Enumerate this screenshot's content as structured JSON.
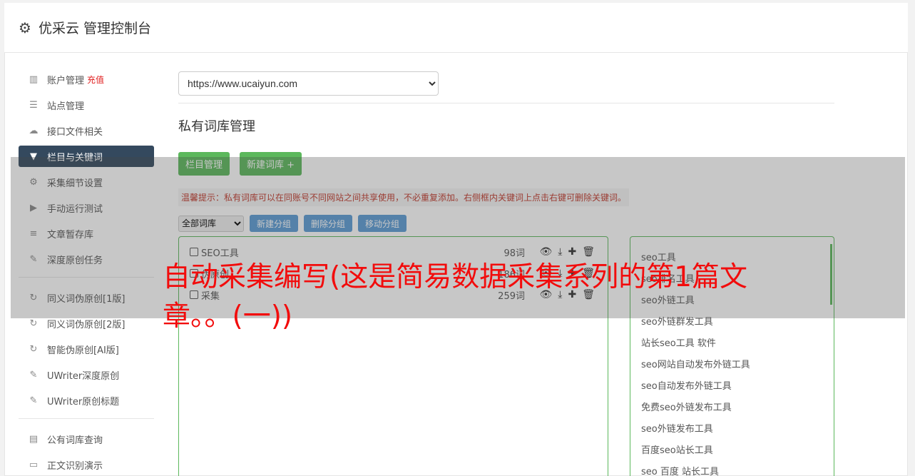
{
  "header": {
    "icon": "gear-icon",
    "title": "优采云 管理控制台"
  },
  "sidebar": {
    "group1": [
      {
        "label": "账户管理",
        "icon": "bar-chart-icon",
        "extra": "充值"
      },
      {
        "label": "站点管理",
        "icon": "server-icon"
      },
      {
        "label": "接口文件相关",
        "icon": "cloud-upload-icon"
      },
      {
        "label": "栏目与关键词",
        "icon": "filter-icon",
        "active": true
      },
      {
        "label": "采集细节设置",
        "icon": "cogs-icon"
      },
      {
        "label": "手动运行测试",
        "icon": "play-icon"
      },
      {
        "label": "文章暂存库",
        "icon": "database-icon"
      },
      {
        "label": "深度原创任务",
        "icon": "edit-icon"
      }
    ],
    "group2": [
      {
        "label": "同义词伪原创[1版]",
        "icon": "refresh-icon"
      },
      {
        "label": "同义词伪原创[2版]",
        "icon": "refresh-icon"
      },
      {
        "label": "智能伪原创[AI版]",
        "icon": "refresh-icon"
      },
      {
        "label": "UWriter深度原创",
        "icon": "edit-icon"
      },
      {
        "label": "UWriter原创标题",
        "icon": "edit-icon"
      }
    ],
    "group3": [
      {
        "label": "公有词库查询",
        "icon": "book-icon"
      },
      {
        "label": "正文识别演示",
        "icon": "monitor-icon"
      }
    ]
  },
  "main": {
    "site_select": "https://www.ucaiyun.com",
    "page_title": "私有词库管理",
    "btn_column": "栏目管理",
    "btn_new_lib": "新建词库 +",
    "tip": "温馨提示：私有词库可以在同账号不同网站之间共享使用，不必重复添加。右侧框内关键词上点击右键可删除关键词。",
    "group_select": "全部词库",
    "btn_new_group": "新建分组",
    "btn_delete_group": "删除分组",
    "btn_move_group": "移动分组",
    "libraries": [
      {
        "name": "SEO工具",
        "count": "98词"
      },
      {
        "name": "伪原创",
        "count": "186词"
      },
      {
        "name": "采集",
        "count": "259词"
      }
    ],
    "keywords": [
      "seo工具",
      "seo排名工具",
      "seo外链工具",
      "seo外链群发工具",
      "站长seo工具 软件",
      "seo网站自动发布外链工具",
      "seo自动发布外链工具",
      "免费seo外链发布工具",
      "seo外链发布工具",
      "百度seo站长工具",
      "seo 百度 站长工具"
    ]
  },
  "overlay": {
    "headline": "自动采集编写(这是简易数据采集系列的第1篇文章。。(一))"
  },
  "colors": {
    "accent": "#5cb85c",
    "sidebar_active": "#34495e",
    "headline": "#f20c0c",
    "tip": "#c0392b",
    "blue_button": "#5b9bd5"
  }
}
